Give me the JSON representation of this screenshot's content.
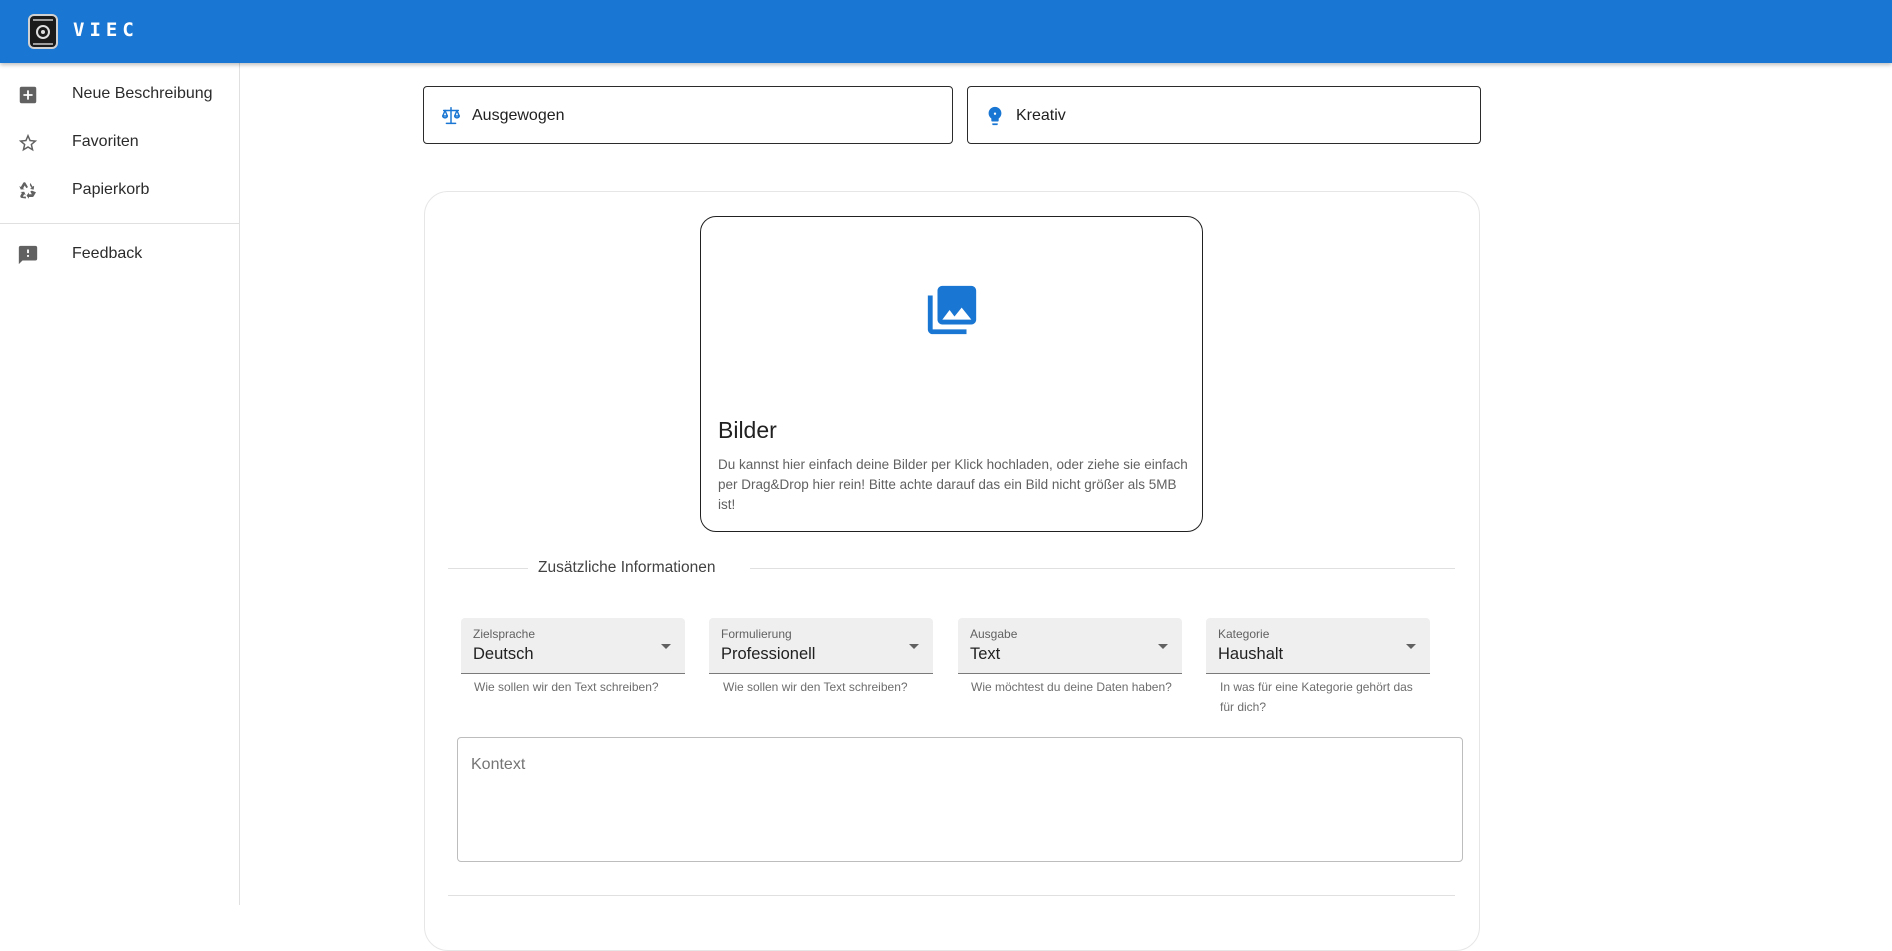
{
  "app": {
    "brand": "VIEC"
  },
  "sidebar": {
    "items": [
      {
        "label": "Neue Beschreibung",
        "icon": "add-box-icon"
      },
      {
        "label": "Favoriten",
        "icon": "star-outline-icon"
      },
      {
        "label": "Papierkorb",
        "icon": "recycle-icon"
      },
      {
        "label": "Feedback",
        "icon": "feedback-icon"
      }
    ]
  },
  "modes": [
    {
      "label": "Ausgewogen",
      "icon": "balance-scale-icon"
    },
    {
      "label": "Kreativ",
      "icon": "lightbulb-icon"
    }
  ],
  "upload": {
    "title": "Bilder",
    "description": "Du kannst hier einfach deine Bilder per Klick hochladen, oder ziehe sie einfach per Drag&Drop hier rein! Bitte achte darauf das ein Bild nicht größer als 5MB ist!",
    "icon": "photo-library-icon"
  },
  "section": {
    "title": "Zusätzliche Informationen"
  },
  "fields": [
    {
      "label": "Zielsprache",
      "value": "Deutsch",
      "hint": "Wie sollen wir den Text schreiben?"
    },
    {
      "label": "Formulierung",
      "value": "Professionell",
      "hint": "Wie sollen wir den Text schreiben?"
    },
    {
      "label": "Ausgabe",
      "value": "Text",
      "hint": "Wie möchtest du deine Daten haben?"
    },
    {
      "label": "Kategorie",
      "value": "Haushalt",
      "hint": "In was für eine Kategorie gehört das für dich?"
    }
  ],
  "context": {
    "placeholder": "Kontext"
  },
  "colors": {
    "primary": "#1976d2",
    "icon_grey": "#616161"
  }
}
